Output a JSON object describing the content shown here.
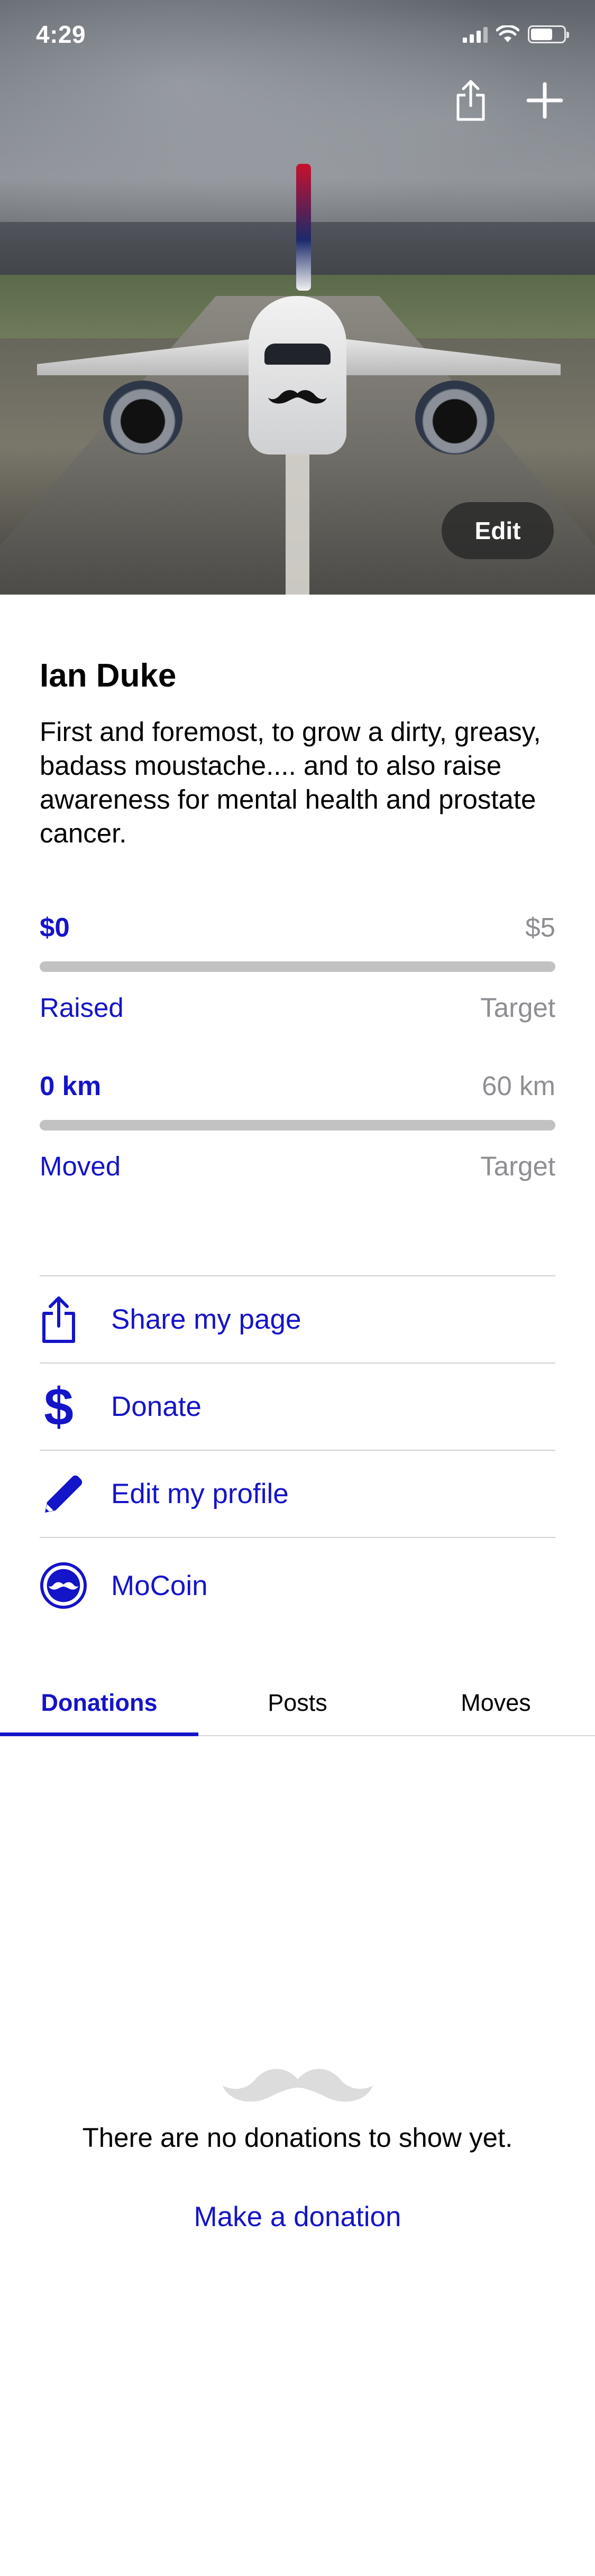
{
  "status_bar": {
    "time": "4:29"
  },
  "hero": {
    "edit_label": "Edit",
    "icons": [
      "share-icon",
      "plus-icon"
    ]
  },
  "profile": {
    "name": "Ian Duke",
    "bio": "First and foremost, to grow a dirty, greasy, badass moustache.... and to also raise awareness for mental health and prostate cancer."
  },
  "fundraising": {
    "current": "$0",
    "target": "$5",
    "current_label": "Raised",
    "target_label": "Target",
    "progress": 0
  },
  "movement": {
    "current": "0 km",
    "target": "60 km",
    "current_label": "Moved",
    "target_label": "Target",
    "progress": 0
  },
  "actions": [
    {
      "label": "Share my page",
      "icon": "share-icon"
    },
    {
      "label": "Donate",
      "icon": "dollar-icon"
    },
    {
      "label": "Edit my profile",
      "icon": "pencil-icon"
    },
    {
      "label": "MoCoin",
      "icon": "mocoin-icon"
    }
  ],
  "tabs": [
    {
      "label": "Donations",
      "active": true
    },
    {
      "label": "Posts",
      "active": false
    },
    {
      "label": "Moves",
      "active": false
    }
  ],
  "empty_state": {
    "message": "There are no donations to show yet.",
    "cta": "Make a donation"
  },
  "colors": {
    "accent": "#1414c8",
    "muted": "#8e8e93",
    "track": "#c2c2c2"
  }
}
